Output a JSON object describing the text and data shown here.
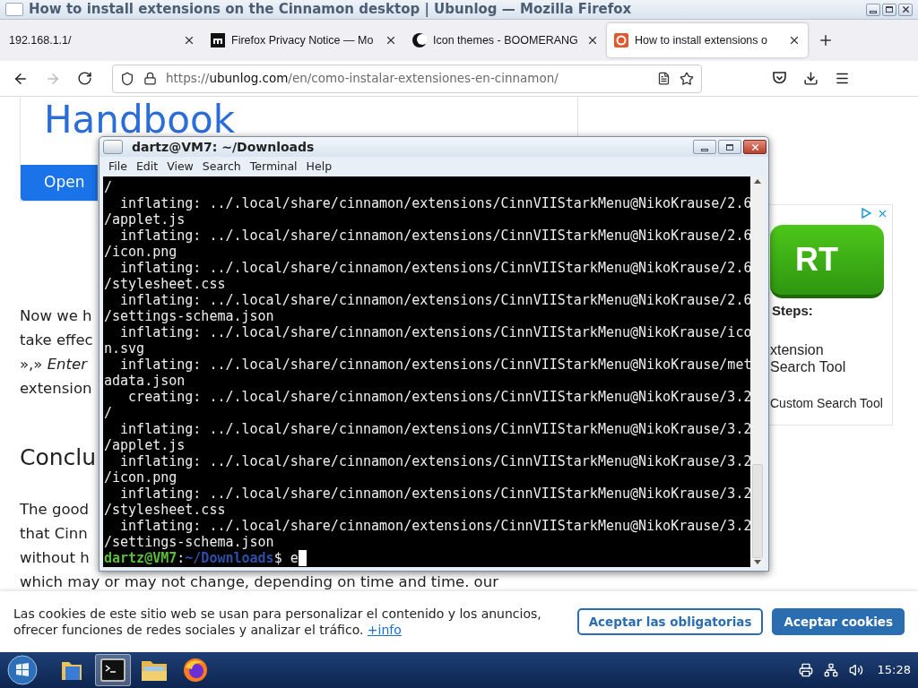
{
  "window": {
    "title": "How to install extensions on the Cinnamon desktop | Ubunlog — Mozilla Firefox"
  },
  "tabs": [
    {
      "label": "192.168.1.1/",
      "kind": "plain",
      "selected": false
    },
    {
      "label": "Firefox Privacy Notice — Mo",
      "kind": "mozilla",
      "selected": false
    },
    {
      "label": "Icon themes - BOOMERANG",
      "kind": "moon",
      "selected": false
    },
    {
      "label": "How to install extensions o",
      "kind": "ubunlog",
      "selected": true
    }
  ],
  "address_bar": {
    "scheme": "https://",
    "domain": "ubunlog.com",
    "path": "/en/como-instalar-extensiones-en-cinnamon/"
  },
  "page": {
    "card": {
      "heading": "Handbook",
      "button": "Open"
    },
    "paragraph_1": [
      "Now we h",
      "take effec",
      "»,» *Enter*",
      "extension"
    ],
    "heading": "Conclu",
    "paragraph_2": [
      "The good",
      "that Cinn",
      "without h",
      "which may or may not change, depending on time and time. our"
    ],
    "ad": {
      "button": "RT",
      "title": "Steps:",
      "lines": [
        "xtension",
        "Search Tool",
        "Custom Search Tool"
      ]
    }
  },
  "terminal": {
    "title": "dartz@VM7: ~/Downloads",
    "menu": [
      "File",
      "Edit",
      "View",
      "Search",
      "Terminal",
      "Help"
    ],
    "lines": [
      "/",
      "  inflating: ../.local/share/cinnamon/extensions/CinnVIIStarkMenu@NikoKrause/2.6",
      "/applet.js",
      "  inflating: ../.local/share/cinnamon/extensions/CinnVIIStarkMenu@NikoKrause/2.6",
      "/icon.png",
      "  inflating: ../.local/share/cinnamon/extensions/CinnVIIStarkMenu@NikoKrause/2.6",
      "/stylesheet.css",
      "  inflating: ../.local/share/cinnamon/extensions/CinnVIIStarkMenu@NikoKrause/2.6",
      "/settings-schema.json",
      "  inflating: ../.local/share/cinnamon/extensions/CinnVIIStarkMenu@NikoKrause/ico",
      "n.svg",
      "  inflating: ../.local/share/cinnamon/extensions/CinnVIIStarkMenu@NikoKrause/met",
      "adata.json",
      "   creating: ../.local/share/cinnamon/extensions/CinnVIIStarkMenu@NikoKrause/3.2",
      "/",
      "  inflating: ../.local/share/cinnamon/extensions/CinnVIIStarkMenu@NikoKrause/3.2",
      "/applet.js",
      "  inflating: ../.local/share/cinnamon/extensions/CinnVIIStarkMenu@NikoKrause/3.2",
      "/icon.png",
      "  inflating: ../.local/share/cinnamon/extensions/CinnVIIStarkMenu@NikoKrause/3.2",
      "/stylesheet.css",
      "  inflating: ../.local/share/cinnamon/extensions/CinnVIIStarkMenu@NikoKrause/3.2",
      "/settings-schema.json"
    ],
    "prompt": {
      "user": "dartz@VM7",
      "separator": ":",
      "path": "~/Downloads",
      "symbol": "$",
      "input": "e"
    }
  },
  "cookie_banner": {
    "text": "Las cookies de este sitio web se usan para personalizar el contenido y los anuncios, ofrecer funciones de redes sociales y analizar el tráfico.",
    "link": "+info",
    "buttons": [
      {
        "label": "Aceptar las obligatorias",
        "kind": "outline"
      },
      {
        "label": "Aceptar cookies",
        "kind": "filled"
      }
    ]
  },
  "taskbar": {
    "apps": [
      {
        "kind": "folder",
        "active": false
      },
      {
        "kind": "terminal",
        "active": true
      },
      {
        "kind": "files",
        "active": false
      },
      {
        "kind": "firefox",
        "active": false
      }
    ],
    "clock": "15:28"
  }
}
